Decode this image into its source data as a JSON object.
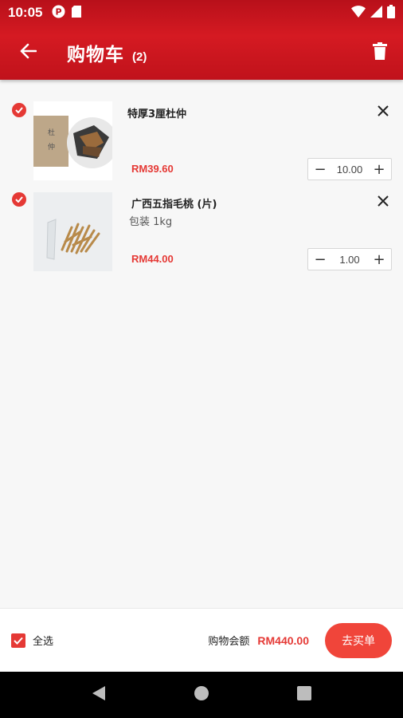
{
  "status_bar": {
    "time": "10:05"
  },
  "app_bar": {
    "title": "购物车",
    "count": "(2)",
    "icons": [
      "back-arrow-icon",
      "trash-icon"
    ]
  },
  "cart": {
    "items": [
      {
        "name": "特厚3厘杜仲",
        "variant": "",
        "price": "RM39.60",
        "quantity": "10.00",
        "selected": true
      },
      {
        "name": "广西五指毛桃 (片)",
        "variant": "包装 1kg",
        "price": "RM44.00",
        "quantity": "1.00",
        "selected": true
      }
    ],
    "stepper": {
      "decrement": "−",
      "increment": "+"
    }
  },
  "footer": {
    "select_all_label": "全选",
    "total_label": "购物会额",
    "total_value": "RM440.00",
    "checkout_label": "去买单"
  },
  "colors": {
    "brand_red": "#d51a22",
    "accent_red": "#e53935",
    "checkout_red": "#f0453a"
  }
}
